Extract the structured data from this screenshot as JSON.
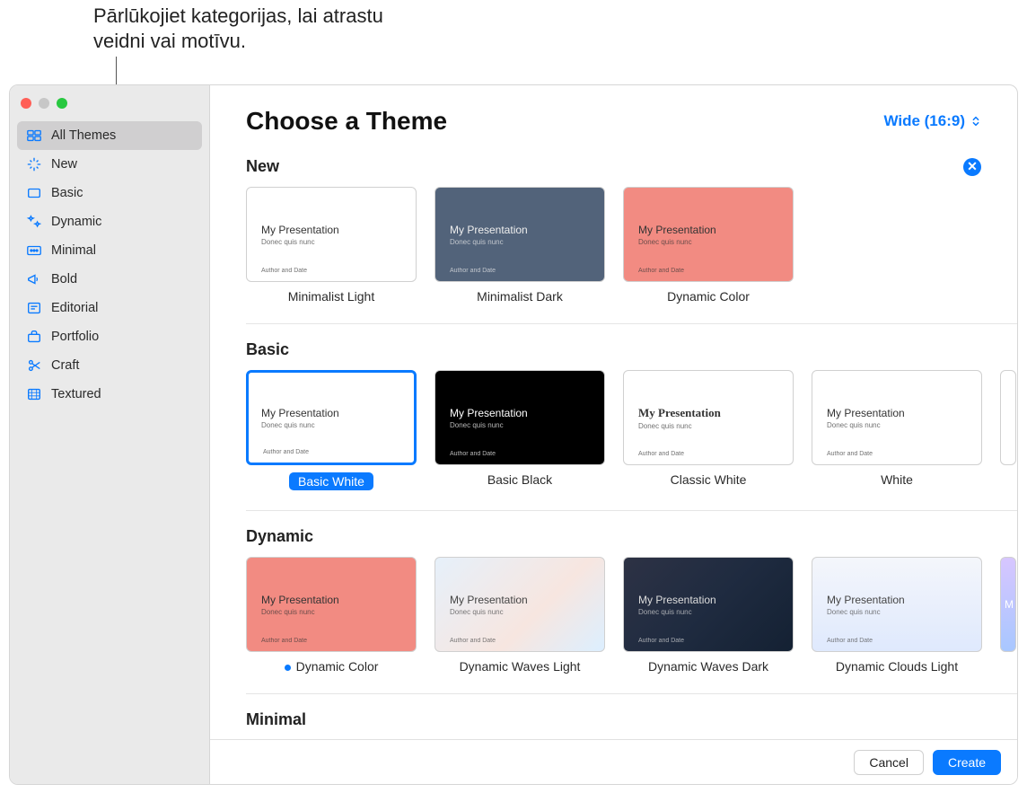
{
  "callout": "Pārlūkojiet kategorijas, lai atrastu veidni vai motīvu.",
  "sidebar": {
    "items": [
      {
        "label": "All Themes",
        "icon": "grid",
        "active": true
      },
      {
        "label": "New",
        "icon": "sparkle",
        "active": false
      },
      {
        "label": "Basic",
        "icon": "rectangle",
        "active": false
      },
      {
        "label": "Dynamic",
        "icon": "stars",
        "active": false
      },
      {
        "label": "Minimal",
        "icon": "dots",
        "active": false
      },
      {
        "label": "Bold",
        "icon": "megaphone",
        "active": false
      },
      {
        "label": "Editorial",
        "icon": "newspaper",
        "active": false
      },
      {
        "label": "Portfolio",
        "icon": "briefcase",
        "active": false
      },
      {
        "label": "Craft",
        "icon": "scissors",
        "active": false
      },
      {
        "label": "Textured",
        "icon": "texture",
        "active": false
      }
    ]
  },
  "header": {
    "title": "Choose a Theme",
    "aspect": "Wide (16:9)"
  },
  "preview": {
    "title": "My Presentation",
    "subtitle": "Donec quis nunc",
    "footer": "Author and Date"
  },
  "sections": [
    {
      "title": "New",
      "closable": true,
      "themes": [
        {
          "label": "Minimalist Light",
          "bg": "bg-white thin"
        },
        {
          "label": "Minimalist Dark",
          "bg": "bg-darkblue thin"
        },
        {
          "label": "Dynamic Color",
          "bg": "bg-coral thin"
        }
      ]
    },
    {
      "title": "Basic",
      "themes": [
        {
          "label": "Basic White",
          "bg": "bg-white",
          "selected": true,
          "pill": true
        },
        {
          "label": "Basic Black",
          "bg": "bg-black"
        },
        {
          "label": "Classic White",
          "bg": "bg-white classic"
        },
        {
          "label": "White",
          "bg": "bg-white thin"
        },
        {
          "label": "",
          "bg": "bg-white",
          "partial": true
        }
      ]
    },
    {
      "title": "Dynamic",
      "themes": [
        {
          "label": "Dynamic Color",
          "bg": "bg-coral",
          "dot": true
        },
        {
          "label": "Dynamic Waves Light",
          "bg": "bg-waves-light"
        },
        {
          "label": "Dynamic Waves Dark",
          "bg": "bg-waves-dark"
        },
        {
          "label": "Dynamic Clouds Light",
          "bg": "bg-clouds-light"
        },
        {
          "label": "M",
          "bg": "bg-partial",
          "partial": true
        }
      ]
    },
    {
      "title": "Minimal",
      "themes": []
    }
  ],
  "footer": {
    "cancel": "Cancel",
    "create": "Create"
  }
}
